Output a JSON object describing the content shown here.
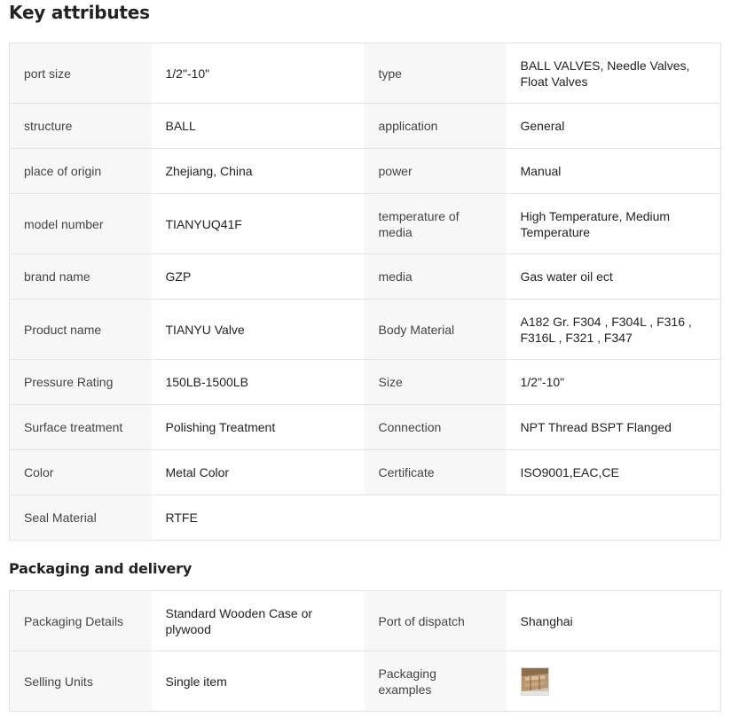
{
  "key_attributes": {
    "title": "Key attributes",
    "rows": [
      {
        "k1": "port size",
        "v1": "1/2\"-10\"",
        "k2": "type",
        "v2": "BALL VALVES, Needle Valves, Float Valves"
      },
      {
        "k1": "structure",
        "v1": "BALL",
        "k2": "application",
        "v2": "General"
      },
      {
        "k1": "place of origin",
        "v1": "Zhejiang, China",
        "k2": "power",
        "v2": "Manual"
      },
      {
        "k1": "model number",
        "v1": "TIANYUQ41F",
        "k2": "temperature of media",
        "v2": "High Temperature, Medium Temperature"
      },
      {
        "k1": "brand name",
        "v1": "GZP",
        "k2": "media",
        "v2": "Gas water oil ect"
      },
      {
        "k1": "Product name",
        "v1": "TIANYU Valve",
        "k2": "Body Material",
        "v2": "A182 Gr. F304 , F304L , F316 , F316L , F321 , F347"
      },
      {
        "k1": "Pressure Rating",
        "v1": "150LB-1500LB",
        "k2": "Size",
        "v2": "1/2\"-10\""
      },
      {
        "k1": "Surface treatment",
        "v1": "Polishing Treatment",
        "k2": "Connection",
        "v2": "NPT Thread BSPT Flanged"
      },
      {
        "k1": "Color",
        "v1": "Metal Color",
        "k2": "Certificate",
        "v2": "ISO9001,EAC,CE"
      },
      {
        "k1": "Seal Material",
        "v1": "RTFE",
        "k2": "",
        "v2": ""
      }
    ]
  },
  "packaging": {
    "title": "Packaging and delivery",
    "rows": [
      {
        "k1": "Packaging Details",
        "v1": "Standard Wooden Case or plywood",
        "k2": "Port of dispatch",
        "v2": "Shanghai"
      },
      {
        "k1": "Selling Units",
        "v1": "Single item",
        "k2": "Packaging examples",
        "v2": ""
      }
    ],
    "example_image_icon": "wooden-case-thumbnail"
  },
  "colors": {
    "label_bg": "#f7f7f7",
    "border": "#e3e3e3",
    "text": "#222222"
  }
}
